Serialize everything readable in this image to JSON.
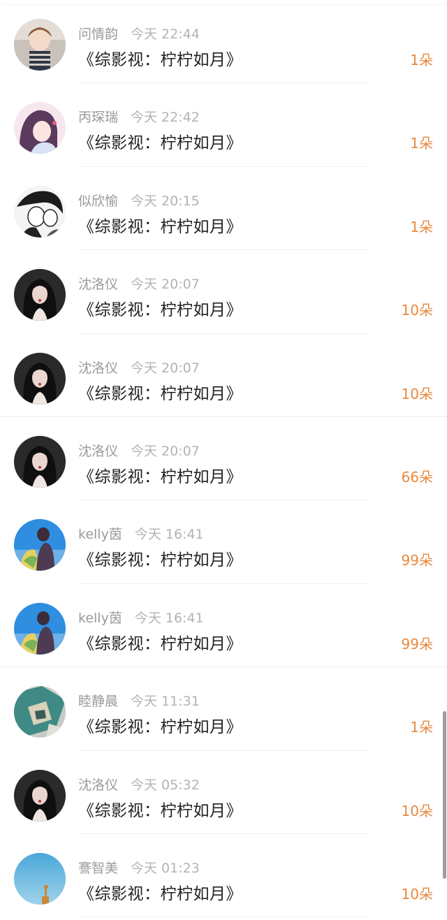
{
  "colors": {
    "count_accent": "#e8893f",
    "name_text": "#9a9a9a",
    "title_text": "#222222"
  },
  "records": [
    {
      "name": "问情韵",
      "time": "今天 22:44",
      "title": "《综影视：柠柠如月》",
      "count": "1朵",
      "avatar": "avatar-girl-icon"
    },
    {
      "name": "丙琛瑞",
      "time": "今天 22:42",
      "title": "《综影视：柠柠如月》",
      "count": "1朵",
      "avatar": "avatar-anime-icon"
    },
    {
      "name": "似欣愉",
      "time": "今天 20:15",
      "title": "《综影视：柠柠如月》",
      "count": "1朵",
      "avatar": "avatar-manga-icon"
    },
    {
      "name": "沈洛仪",
      "time": "今天 20:07",
      "title": "《综影视：柠柠如月》",
      "count": "10朵",
      "avatar": "avatar-woman-dark-icon"
    },
    {
      "name": "沈洛仪",
      "time": "今天 20:07",
      "title": "《综影视：柠柠如月》",
      "count": "10朵",
      "avatar": "avatar-woman-dark-icon"
    },
    {
      "name": "沈洛仪",
      "time": "今天 20:07",
      "title": "《综影视：柠柠如月》",
      "count": "66朵",
      "avatar": "avatar-woman-dark-icon"
    },
    {
      "name": "kelly茵",
      "time": "今天 16:41",
      "title": "《综影视：柠柠如月》",
      "count": "99朵",
      "avatar": "avatar-blue-sky-icon"
    },
    {
      "name": "kelly茵",
      "time": "今天 16:41",
      "title": "《综影视：柠柠如月》",
      "count": "99朵",
      "avatar": "avatar-blue-sky-icon"
    },
    {
      "name": "睦静晨",
      "time": "今天 11:31",
      "title": "《综影视：柠柠如月》",
      "count": "1朵",
      "avatar": "avatar-teal-art-icon"
    },
    {
      "name": "沈洛仪",
      "time": "今天 05:32",
      "title": "《综影视：柠柠如月》",
      "count": "10朵",
      "avatar": "avatar-woman-dark-icon"
    },
    {
      "name": "謇智美",
      "time": "今天 01:23",
      "title": "《综影视：柠柠如月》",
      "count": "10朵",
      "avatar": "avatar-giraffe-sky-icon"
    }
  ]
}
